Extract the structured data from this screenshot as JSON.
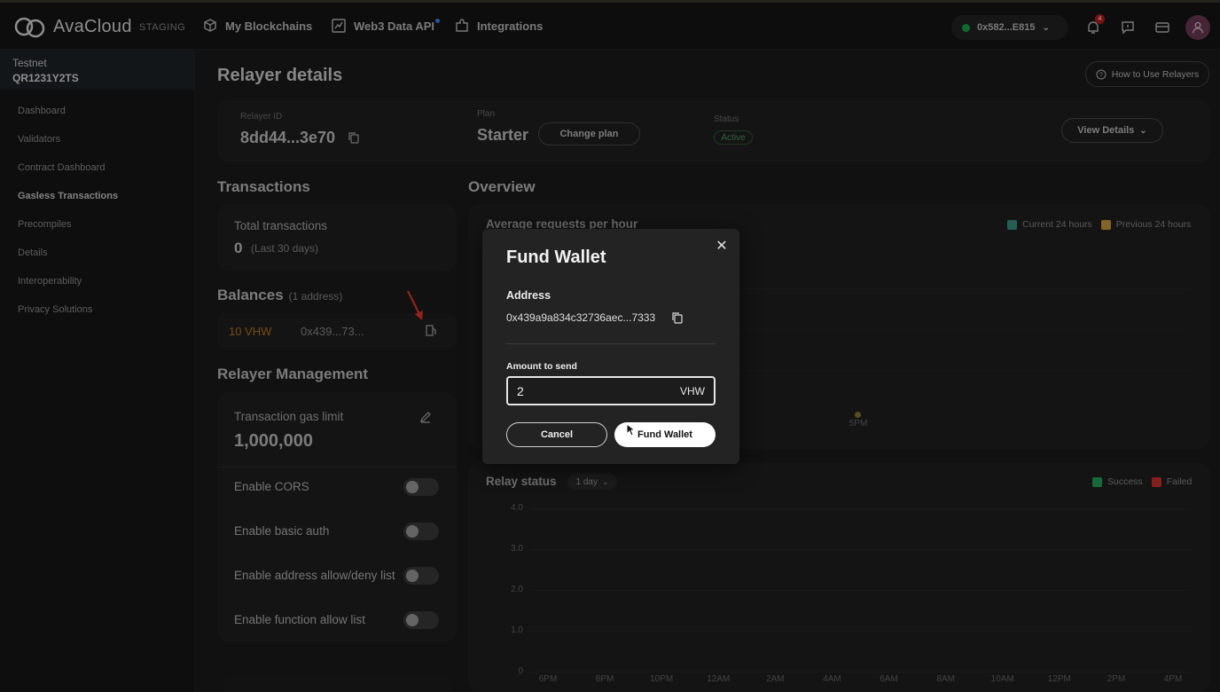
{
  "topbar": {
    "brand": "AvaCloud",
    "env": "STAGING",
    "nav": [
      {
        "label": "My Blockchains",
        "icon": "cube-icon"
      },
      {
        "label": "Web3 Data API",
        "icon": "chart-icon"
      },
      {
        "label": "Integrations",
        "icon": "puzzle-icon"
      }
    ],
    "wallet": "0x582...E815",
    "notifications_count": "4"
  },
  "sidebar": {
    "network": "Testnet",
    "chain_id": "QR1231Y2TS",
    "items": [
      {
        "label": "Dashboard"
      },
      {
        "label": "Validators"
      },
      {
        "label": "Contract Dashboard"
      },
      {
        "label": "Gasless Transactions"
      },
      {
        "label": "Precompiles"
      },
      {
        "label": "Details"
      },
      {
        "label": "Interoperability"
      },
      {
        "label": "Privacy Solutions"
      }
    ]
  },
  "main": {
    "title": "Relayer details",
    "how_to": "How to Use Relayers",
    "summary": {
      "relayer_id_label": "Relayer ID",
      "relayer_id": "8dd44...3e70",
      "plan_label": "Plan",
      "plan": "Starter",
      "change_plan": "Change plan",
      "status_label": "Status",
      "status": "Active",
      "view_details": "View Details"
    },
    "transactions": {
      "title": "Transactions",
      "total_label": "Total transactions",
      "total": "0",
      "period": "(Last 30 days)"
    },
    "balances": {
      "title": "Balances",
      "sub": "(1 address)",
      "amount": "10 VHW",
      "address": "0x439...73..."
    },
    "management": {
      "title": "Relayer Management",
      "gas_label": "Transaction gas limit",
      "gas_value": "1,000,000",
      "toggles": [
        {
          "label": "Enable CORS"
        },
        {
          "label": "Enable basic auth"
        },
        {
          "label": "Enable address allow/deny list"
        },
        {
          "label": "Enable function allow list"
        }
      ]
    },
    "overview": {
      "title": "Overview",
      "avg_title": "Average requests per hour",
      "legend_current": "Current 24 hours",
      "legend_previous": "Previous 24 hours",
      "point_label": "5PM",
      "relay_title": "Relay status",
      "relay_range": "1 day",
      "legend_success": "Success",
      "legend_failed": "Failed"
    }
  },
  "colors": {
    "current": "#3a8f86",
    "previous": "#c99a3b",
    "success": "#22a35a",
    "failed": "#c9302c"
  },
  "chart_data": {
    "type": "bar",
    "title": "Relay status",
    "y_ticks": [
      "4.0",
      "3.0",
      "2.0",
      "1.0",
      "0"
    ],
    "categories": [
      "6PM",
      "8PM",
      "10PM",
      "12AM",
      "2AM",
      "4AM",
      "6AM",
      "8AM",
      "10AM",
      "12PM",
      "2PM",
      "4PM"
    ],
    "series": [
      {
        "name": "Success",
        "values": [
          0,
          0,
          0,
          0,
          0,
          0,
          0,
          0,
          0,
          0,
          0,
          0
        ]
      },
      {
        "name": "Failed",
        "values": [
          0,
          0,
          0,
          0,
          0,
          0,
          0,
          0,
          0,
          0,
          0,
          0
        ]
      }
    ],
    "ylim": [
      0,
      4
    ]
  },
  "modal": {
    "title": "Fund Wallet",
    "address_label": "Address",
    "address": "0x439a9a834c32736aec...7333",
    "amount_label": "Amount to send",
    "amount": "2",
    "unit": "VHW",
    "cancel": "Cancel",
    "submit": "Fund Wallet"
  }
}
